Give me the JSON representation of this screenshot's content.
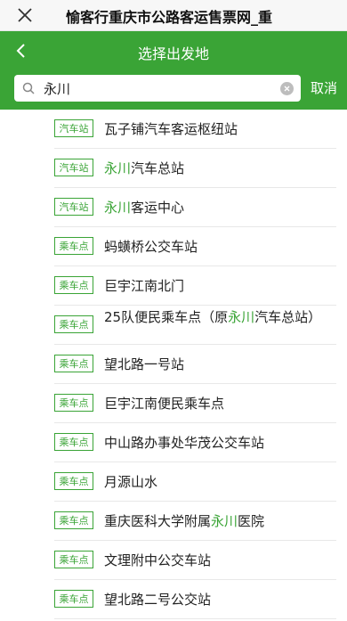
{
  "browser": {
    "title": "愉客行重庆市公路客运售票网_重"
  },
  "header": {
    "title": "选择出发地"
  },
  "search": {
    "value": "永川",
    "cancel_label": "取消"
  },
  "results": [
    {
      "tag": "汽车站",
      "pre": "瓦子铺汽车客运枢纽站",
      "hl": "",
      "post": ""
    },
    {
      "tag": "汽车站",
      "pre": "",
      "hl": "永川",
      "post": "汽车总站"
    },
    {
      "tag": "汽车站",
      "pre": "",
      "hl": "永川",
      "post": "客运中心"
    },
    {
      "tag": "乘车点",
      "pre": "蚂蟥桥公交车站",
      "hl": "",
      "post": ""
    },
    {
      "tag": "乘车点",
      "pre": "巨宇江南北门",
      "hl": "",
      "post": ""
    },
    {
      "tag": "乘车点",
      "pre": "25队便民乘车点（原",
      "hl": "永川",
      "post": "汽车总站）"
    },
    {
      "tag": "乘车点",
      "pre": "望北路一号站",
      "hl": "",
      "post": ""
    },
    {
      "tag": "乘车点",
      "pre": "巨宇江南便民乘车点",
      "hl": "",
      "post": ""
    },
    {
      "tag": "乘车点",
      "pre": "中山路办事处华茂公交车站",
      "hl": "",
      "post": ""
    },
    {
      "tag": "乘车点",
      "pre": "月源山水",
      "hl": "",
      "post": ""
    },
    {
      "tag": "乘车点",
      "pre": "重庆医科大学附属",
      "hl": "永川",
      "post": "医院"
    },
    {
      "tag": "乘车点",
      "pre": "文理附中公交车站",
      "hl": "",
      "post": ""
    },
    {
      "tag": "乘车点",
      "pre": "望北路二号公交站",
      "hl": "",
      "post": ""
    }
  ],
  "colors": {
    "accent": "#3aa436"
  }
}
